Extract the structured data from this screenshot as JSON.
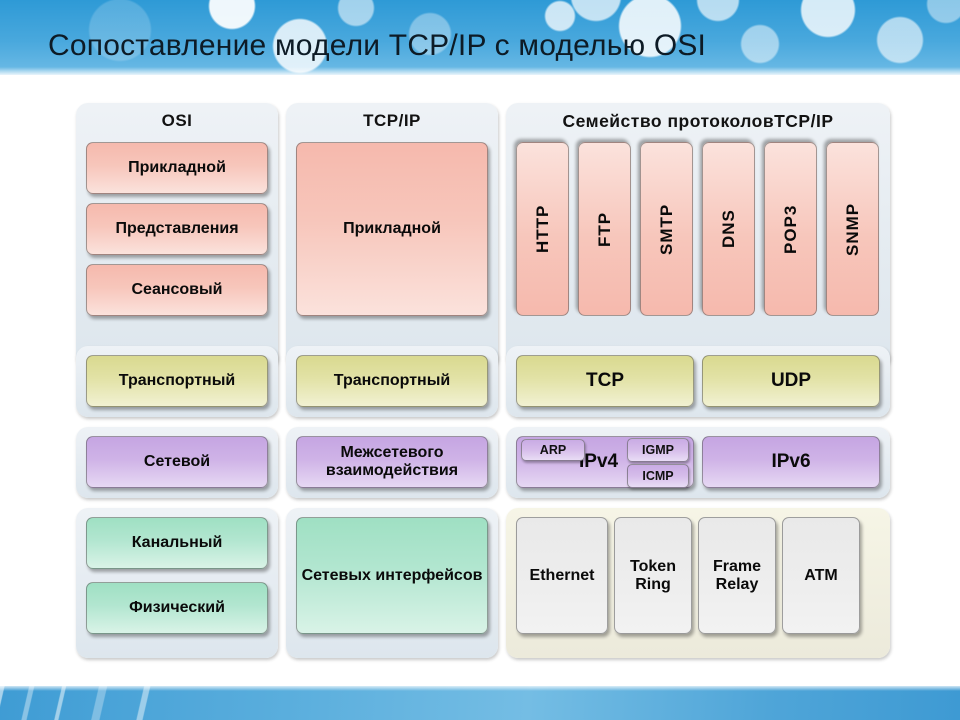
{
  "slide": {
    "title": "Сопоставление модели TCP/IP с моделью OSI",
    "header_color": "#49a8dd",
    "footer_color": "#5aaedd"
  },
  "columns": {
    "osi": {
      "header": "OSI",
      "layers": [
        {
          "label": "Прикладной",
          "color": "#f6b9ad"
        },
        {
          "label": "Представления",
          "color": "#f6b9ad"
        },
        {
          "label": "Сеансовый",
          "color": "#f6b9ad"
        },
        {
          "label": "Транспортный",
          "color": "#d9d98f"
        },
        {
          "label": "Сетевой",
          "color": "#c5a5e2"
        },
        {
          "label": "Канальный",
          "color": "#9fe0c3"
        },
        {
          "label": "Физический",
          "color": "#9fe0c3"
        }
      ]
    },
    "tcpip": {
      "header": "TCP/IP",
      "layers": [
        {
          "label": "Прикладной",
          "color": "#f6b9ad"
        },
        {
          "label": "Транспортный",
          "color": "#d9d98f"
        },
        {
          "label": "Межсетевого взаимодействия",
          "color": "#c5a5e2"
        },
        {
          "label": "Сетевых интерфейсов",
          "color": "#9fe0c3"
        }
      ]
    },
    "protocols": {
      "header": "Семейство протоколовTCP/IP",
      "application": [
        {
          "label": "HTTP"
        },
        {
          "label": "FTP"
        },
        {
          "label": "SMTP"
        },
        {
          "label": "DNS"
        },
        {
          "label": "POP3"
        },
        {
          "label": "SNMP"
        }
      ],
      "transport": [
        {
          "label": "TCP"
        },
        {
          "label": "UDP"
        }
      ],
      "internet": {
        "ipv4": "IPv4",
        "ipv6": "IPv6",
        "badges": [
          {
            "label": "ARP"
          },
          {
            "label": "IGMP"
          },
          {
            "label": "ICMP"
          }
        ]
      },
      "link": [
        {
          "label": "Ethernet"
        },
        {
          "label": "Token Ring"
        },
        {
          "label": "Frame Relay"
        },
        {
          "label": "ATM"
        }
      ]
    }
  }
}
